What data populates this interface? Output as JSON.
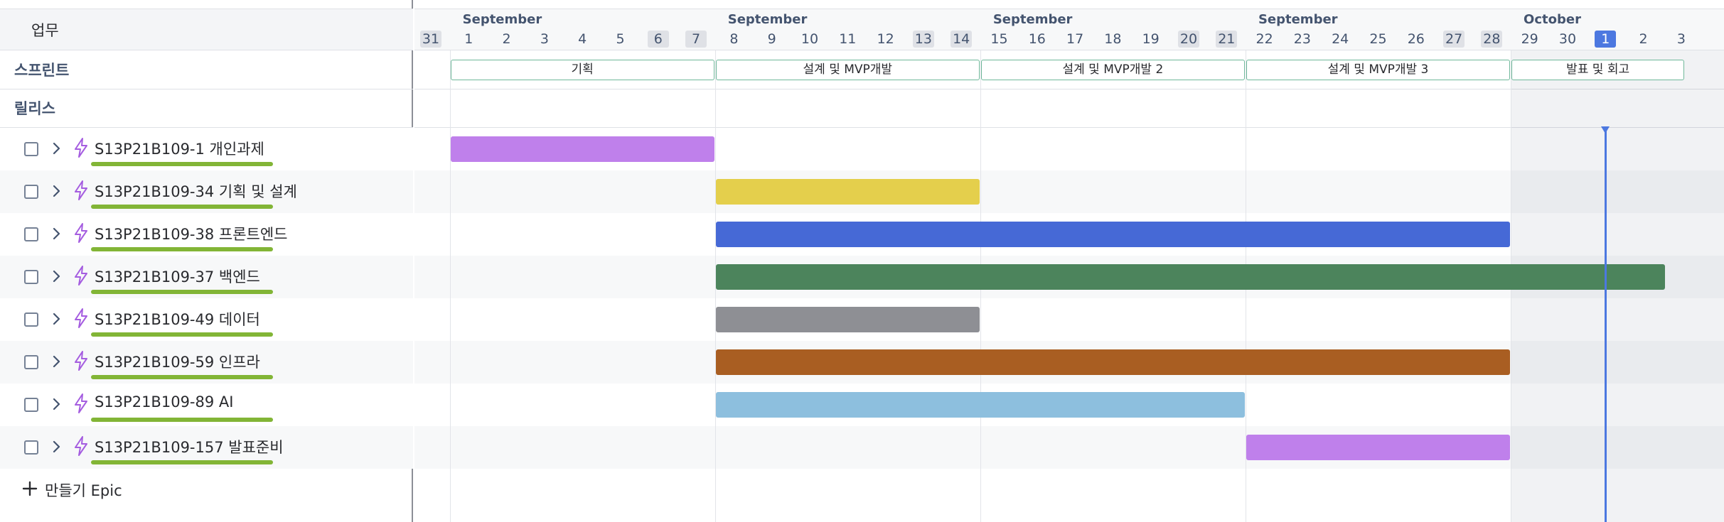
{
  "left_panel": {
    "header_label": "업무",
    "sprint_label": "스프린트",
    "release_label": "릴리스",
    "epics": [
      {
        "label": "S13P21B109-1 개인과제"
      },
      {
        "label": "S13P21B109-34 기획 및 설계"
      },
      {
        "label": "S13P21B109-38 프론트엔드"
      },
      {
        "label": "S13P21B109-37 백엔드"
      },
      {
        "label": "S13P21B109-49 데이터"
      },
      {
        "label": "S13P21B109-59 인프라"
      },
      {
        "label": "S13P21B109-89 AI"
      },
      {
        "label": "S13P21B109-157 발표준비"
      }
    ],
    "create_label": "만들기 Epic"
  },
  "timeline": {
    "months": [
      {
        "label": "September"
      },
      {
        "label": "September"
      },
      {
        "label": "September"
      },
      {
        "label": "September"
      },
      {
        "label": "October"
      }
    ],
    "days": [
      {
        "label": "31",
        "weekend": true
      },
      {
        "label": "1"
      },
      {
        "label": "2"
      },
      {
        "label": "3"
      },
      {
        "label": "4"
      },
      {
        "label": "5"
      },
      {
        "label": "6",
        "weekend": true
      },
      {
        "label": "7",
        "weekend": true
      },
      {
        "label": "8"
      },
      {
        "label": "9"
      },
      {
        "label": "10"
      },
      {
        "label": "11"
      },
      {
        "label": "12"
      },
      {
        "label": "13",
        "weekend": true
      },
      {
        "label": "14",
        "weekend": true
      },
      {
        "label": "15"
      },
      {
        "label": "16"
      },
      {
        "label": "17"
      },
      {
        "label": "18"
      },
      {
        "label": "19"
      },
      {
        "label": "20",
        "weekend": true
      },
      {
        "label": "21",
        "weekend": true
      },
      {
        "label": "22"
      },
      {
        "label": "23"
      },
      {
        "label": "24"
      },
      {
        "label": "25"
      },
      {
        "label": "26"
      },
      {
        "label": "27",
        "weekend": true
      },
      {
        "label": "28",
        "weekend": true
      },
      {
        "label": "29"
      },
      {
        "label": "30"
      },
      {
        "label": "1",
        "today": true
      },
      {
        "label": "2"
      },
      {
        "label": "3"
      }
    ],
    "sprints": [
      {
        "label": "기획"
      },
      {
        "label": "설계 및 MVP개발"
      },
      {
        "label": "설계 및 MVP개발 2"
      },
      {
        "label": "설계 및 MVP개발 3"
      },
      {
        "label": "발표 및 회고"
      }
    ],
    "bars": [
      {
        "start": "09-01",
        "end": "09-07",
        "color": "#bf80eb"
      },
      {
        "start": "09-08",
        "end": "09-14",
        "color": "#e4cf4c"
      },
      {
        "start": "09-08",
        "end": "09-28",
        "color": "#4669d6"
      },
      {
        "start": "09-08",
        "end": "10-02",
        "color": "#4c845c"
      },
      {
        "start": "09-08",
        "end": "09-14",
        "color": "#8e8f94"
      },
      {
        "start": "09-08",
        "end": "09-28",
        "color": "#a95e22"
      },
      {
        "start": "09-08",
        "end": "09-21",
        "color": "#8dbfde"
      },
      {
        "start": "09-22",
        "end": "09-28",
        "color": "#bf80eb"
      }
    ]
  },
  "colors": {
    "epic_icon": "#a55de0",
    "progress": "#82b536",
    "today": "#4c78e0",
    "sprint_border": "#6fb89a"
  }
}
